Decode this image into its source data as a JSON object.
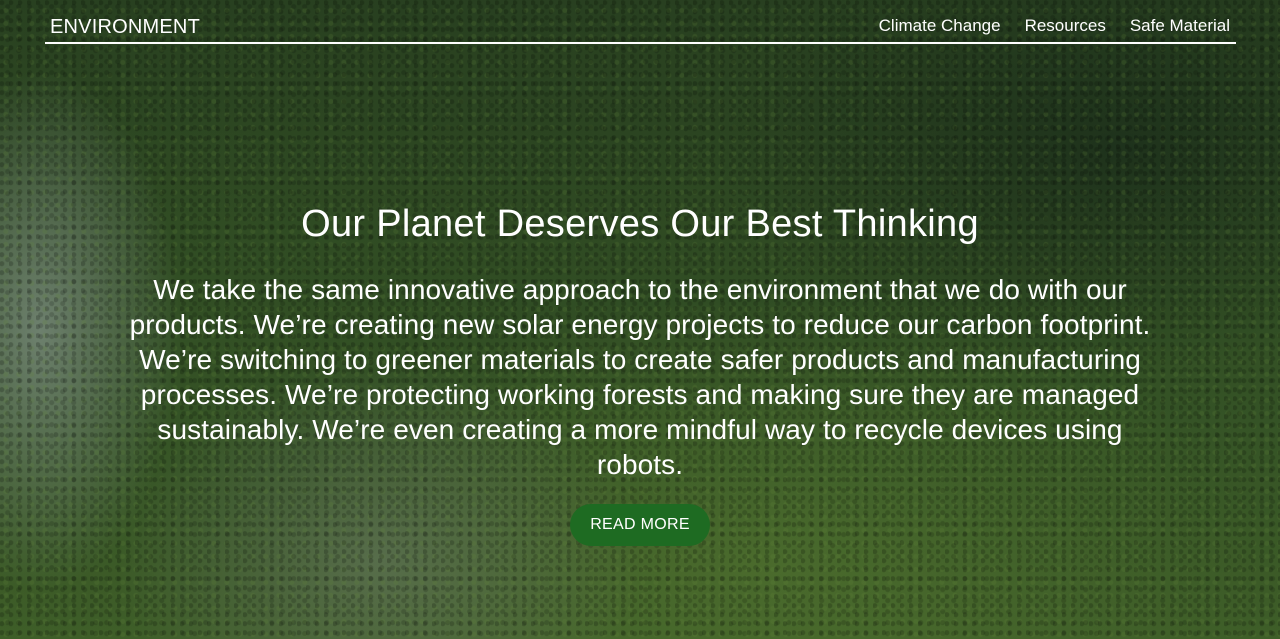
{
  "nav": {
    "brand": "ENVIRONMENT",
    "links": [
      "Climate Change",
      "Resources",
      "Safe Material"
    ]
  },
  "hero": {
    "headline": "Our Planet Deserves Our Best Thinking",
    "body": "We take the same innovative approach to the environment that we do with our products. We’re creating new solar energy projects to reduce our carbon footprint. We’re switching to greener materials to create safer products and manufacturing processes. We’re protecting working forests and making sure they are managed sustainably. We’re even creating a more mindful way to recycle devices using robots.",
    "cta_label": "READ MORE"
  },
  "colors": {
    "cta_background": "#1e6b22",
    "text": "#ffffff"
  }
}
